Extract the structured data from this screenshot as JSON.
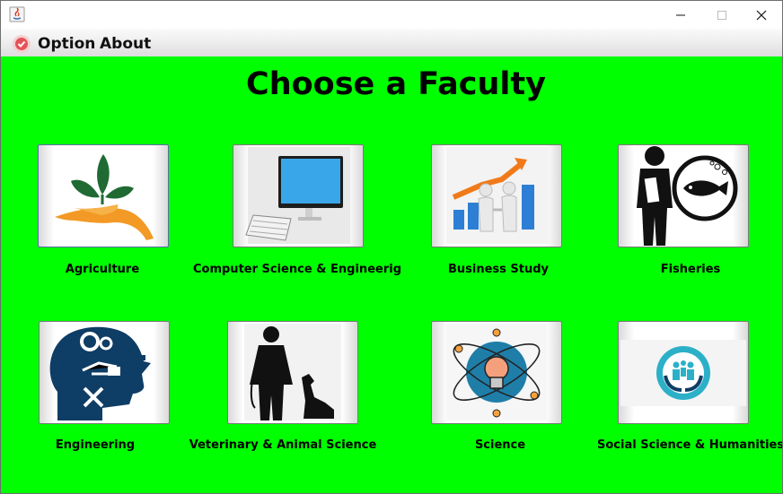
{
  "window": {
    "minimize_icon": "minimize-icon",
    "maximize_icon": "maximize-icon",
    "close_icon": "close-icon"
  },
  "menu": {
    "items": [
      {
        "label": "Option"
      },
      {
        "label": "About"
      }
    ]
  },
  "main": {
    "heading": "Choose a Faculty",
    "faculties": [
      {
        "label": "Agriculture",
        "icon": "plant-hand-icon"
      },
      {
        "label": "Computer Science & Engineerig",
        "icon": "computer-icon"
      },
      {
        "label": "Business Study",
        "icon": "business-growth-icon"
      },
      {
        "label": "Fisheries",
        "icon": "fisheries-icon"
      },
      {
        "label": "Engineering",
        "icon": "engineering-head-icon"
      },
      {
        "label": "Veterinary & Animal Science",
        "icon": "veterinarian-dog-icon"
      },
      {
        "label": "Science",
        "icon": "science-bulb-icon"
      },
      {
        "label": "Social Science & Humanities",
        "icon": "people-hands-icon"
      }
    ]
  },
  "colors": {
    "background": "#00ff00",
    "heading": "#000000"
  }
}
